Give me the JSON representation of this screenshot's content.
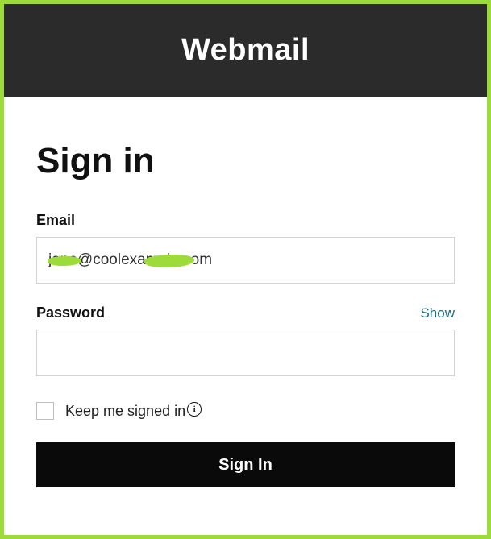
{
  "header": {
    "title": "Webmail"
  },
  "form": {
    "heading": "Sign in",
    "email_label": "Email",
    "email_value": "jane@coolexample.com",
    "password_label": "Password",
    "password_value": "",
    "show_label": "Show",
    "keep_signed_label": "Keep me signed in",
    "info_glyph": "i",
    "submit_label": "Sign In"
  }
}
